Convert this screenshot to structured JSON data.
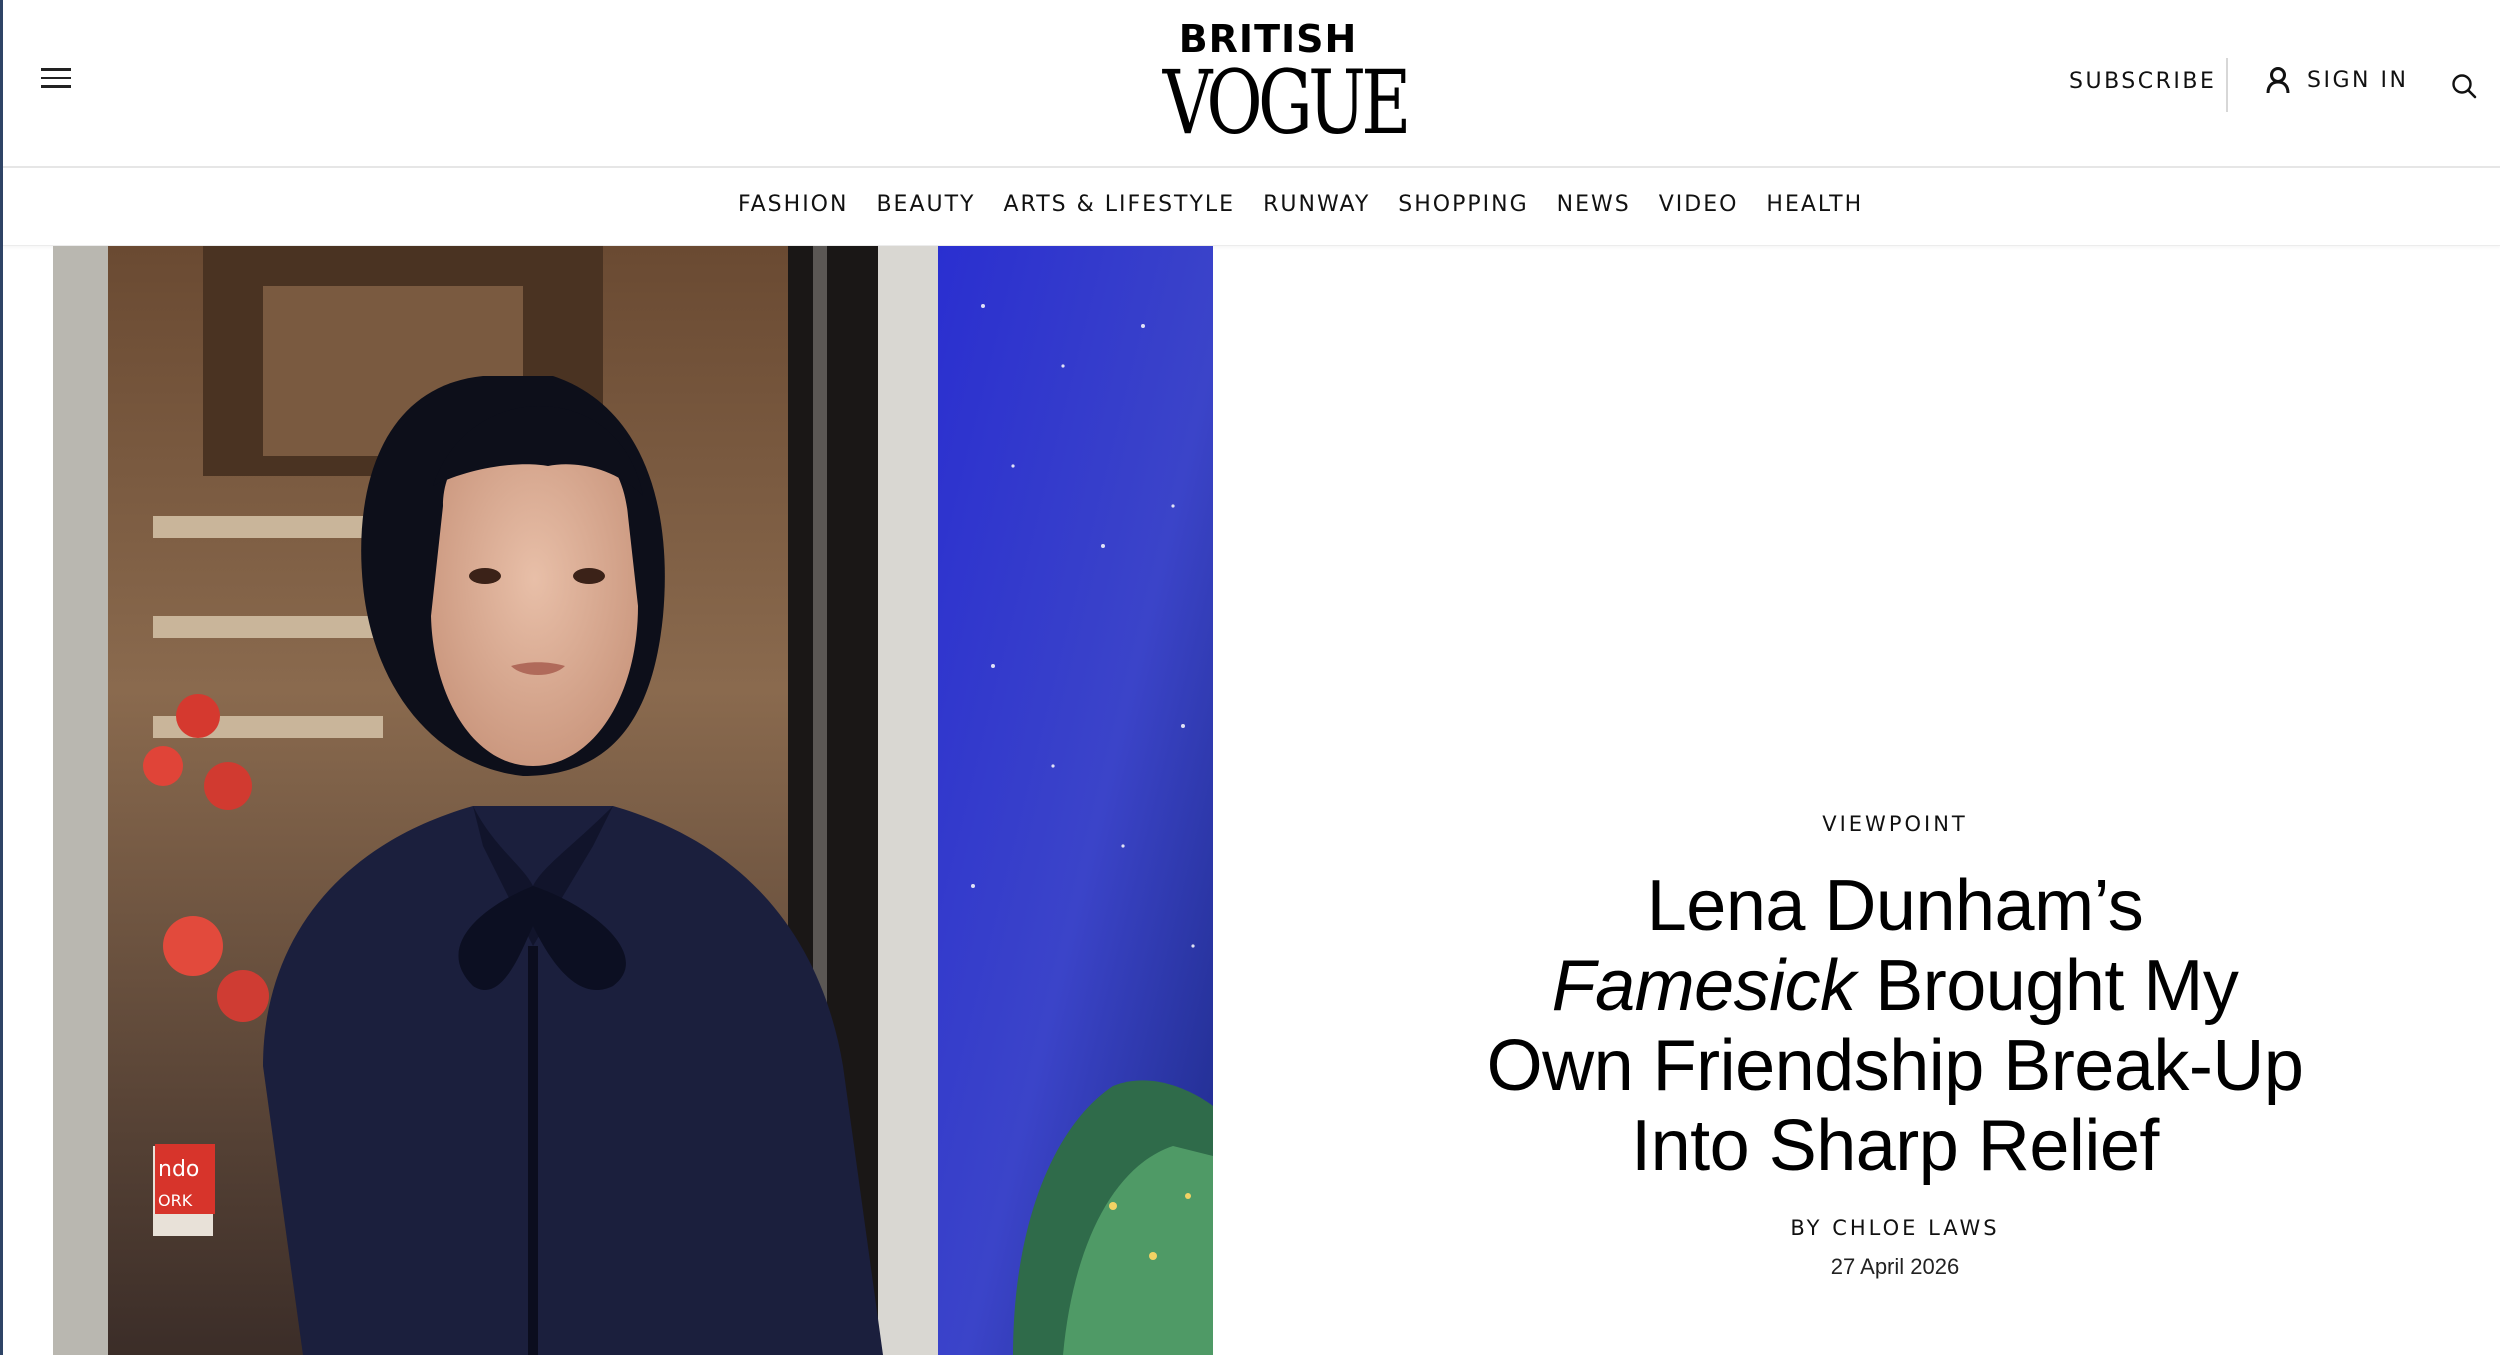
{
  "brand": {
    "line1": "BRITISH",
    "line2": "VOGUE"
  },
  "header": {
    "subscribe_label": "SUBSCRIBE",
    "sign_in_label": "SIGN IN"
  },
  "nav": {
    "items": [
      {
        "label": "FASHION"
      },
      {
        "label": "BEAUTY"
      },
      {
        "label": "ARTS & LIFESTYLE"
      },
      {
        "label": "RUNWAY"
      },
      {
        "label": "SHOPPING"
      },
      {
        "label": "NEWS"
      },
      {
        "label": "VIDEO"
      },
      {
        "label": "HEALTH"
      }
    ]
  },
  "article": {
    "rubric": "VIEWPOINT",
    "headline_part1": "Lena Dunham’s",
    "headline_italic": "Famesick",
    "headline_part2": "Brought My Own Friendship Break-Up Into Sharp Relief",
    "byline_prefix": "BY",
    "author": "CHLOE LAWS",
    "date": "27 April 2026"
  },
  "image_sign_text": {
    "line1": "ndo",
    "line2": "ORK"
  },
  "icons": {
    "menu": "hamburger-menu-icon",
    "account": "user-icon",
    "search": "search-icon"
  },
  "colors": {
    "text": "#000000",
    "accent_sidebar": "#2f4466",
    "divider": "#d7d7d7",
    "coat": "#1b1f3d",
    "backdrop": "#3a3fc4"
  }
}
